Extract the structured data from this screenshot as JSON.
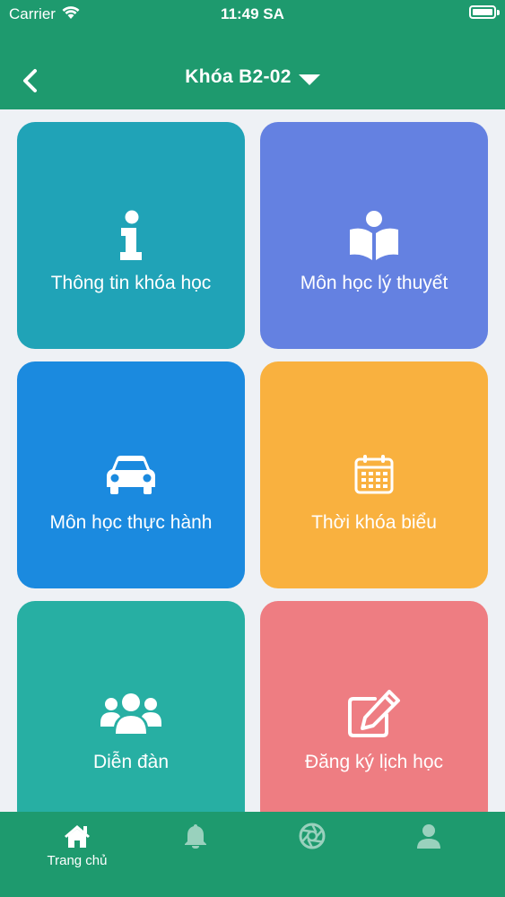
{
  "status_bar": {
    "carrier": "Carrier",
    "time": "11:49 SA"
  },
  "nav": {
    "title": "Khóa B2-02"
  },
  "colors": {
    "header": "#1e9a6e",
    "tile_info": "#20a3b7",
    "tile_theory": "#6481e1",
    "tile_practice": "#1b8adf",
    "tile_schedule": "#f9b13f",
    "tile_forum": "#27afa3",
    "tile_register": "#ee7d82"
  },
  "tiles": [
    {
      "label": "Thông tin khóa học",
      "icon": "info-icon"
    },
    {
      "label": "Môn học lý thuyết",
      "icon": "book-icon"
    },
    {
      "label": "Môn học thực hành",
      "icon": "car-icon"
    },
    {
      "label": "Thời khóa biểu",
      "icon": "calendar-icon"
    },
    {
      "label": "Diễn đàn",
      "icon": "users-icon"
    },
    {
      "label": "Đăng ký lịch học",
      "icon": "edit-icon"
    }
  ],
  "tabbar": [
    {
      "label": "Trang chủ",
      "icon": "home-icon"
    },
    {
      "label": "",
      "icon": "bell-icon"
    },
    {
      "label": "",
      "icon": "aperture-icon"
    },
    {
      "label": "",
      "icon": "user-icon"
    }
  ]
}
